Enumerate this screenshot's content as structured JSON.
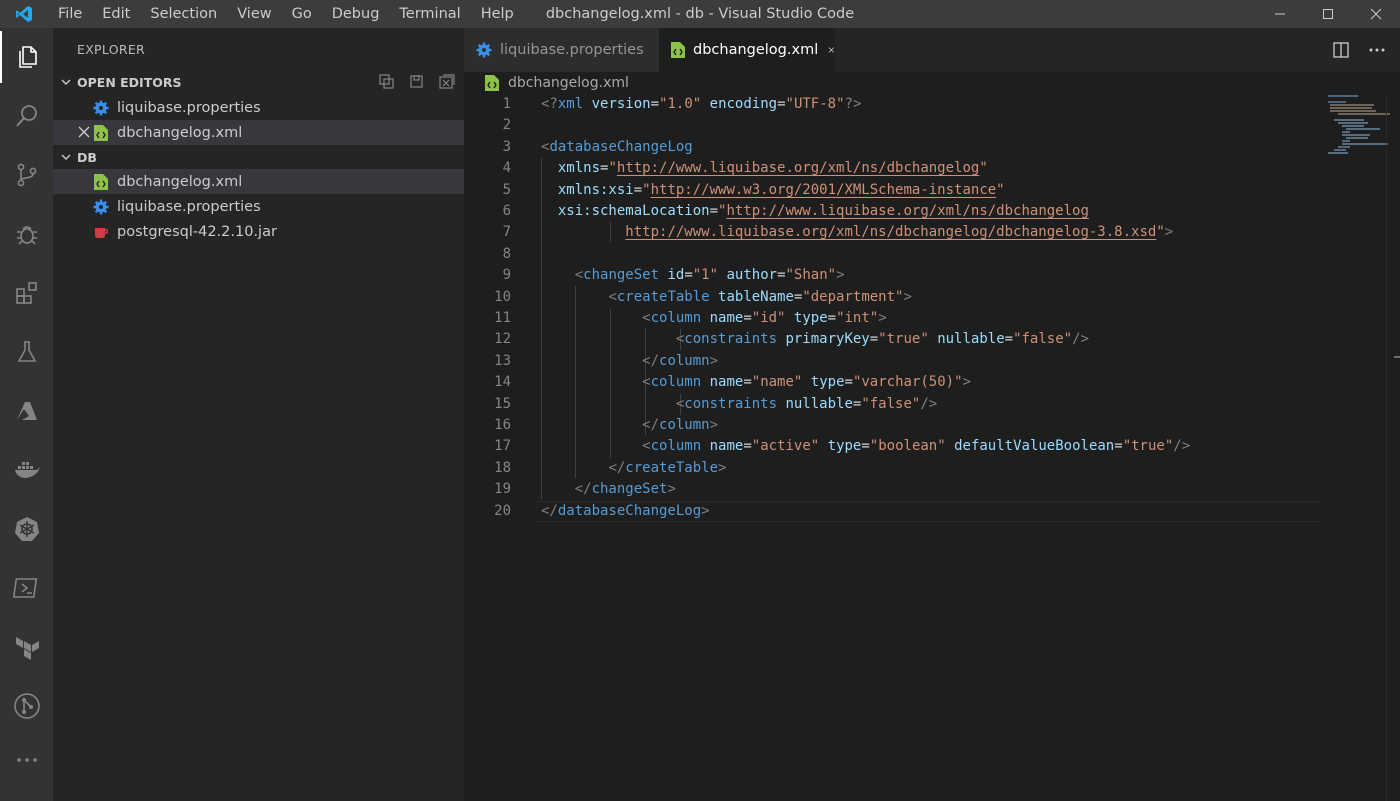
{
  "window": {
    "title": "dbchangelog.xml - db - Visual Studio Code",
    "menu": [
      "File",
      "Edit",
      "Selection",
      "View",
      "Go",
      "Debug",
      "Terminal",
      "Help"
    ]
  },
  "activity_bar": {
    "items": [
      "explorer-icon",
      "search-icon",
      "source-control-icon",
      "debug-icon",
      "extensions-icon",
      "test-flask-icon",
      "azure-icon",
      "docker-icon",
      "kubernetes-icon",
      "terminal-icon",
      "terraform-icon",
      "git-graph-icon",
      "more-icon"
    ],
    "active": "explorer-icon"
  },
  "sidebar": {
    "title": "EXPLORER",
    "open_editors": {
      "header": "OPEN EDITORS",
      "items": [
        {
          "label": "liquibase.properties",
          "icon": "gear-icon"
        },
        {
          "label": "dbchangelog.xml",
          "icon": "xml-file-icon"
        }
      ]
    },
    "folder": {
      "header": "DB",
      "items": [
        {
          "label": "dbchangelog.xml",
          "icon": "xml-file-icon"
        },
        {
          "label": "liquibase.properties",
          "icon": "gear-icon"
        },
        {
          "label": "postgresql-42.2.10.jar",
          "icon": "java-cup-icon"
        }
      ]
    }
  },
  "tabs": [
    {
      "label": "liquibase.properties",
      "icon": "gear-icon",
      "active": false
    },
    {
      "label": "dbchangelog.xml",
      "icon": "xml-file-icon",
      "active": true
    }
  ],
  "breadcrumb": {
    "file": "dbchangelog.xml"
  },
  "editor": {
    "lines": [
      [
        [
          "<?",
          "punct"
        ],
        [
          "xml",
          "tag"
        ],
        [
          " ",
          "plain"
        ],
        [
          "version",
          "attr"
        ],
        [
          "=",
          "plain"
        ],
        [
          "\"1.0\"",
          "str"
        ],
        [
          " ",
          "plain"
        ],
        [
          "encoding",
          "attr"
        ],
        [
          "=",
          "plain"
        ],
        [
          "\"UTF-8\"",
          "str"
        ],
        [
          "?>",
          "punct"
        ]
      ],
      [],
      [
        [
          "<",
          "punct"
        ],
        [
          "databaseChangeLog",
          "tag"
        ]
      ],
      [
        [
          "  ",
          "plain"
        ],
        [
          "xmlns",
          "attr"
        ],
        [
          "=",
          "plain"
        ],
        [
          "\"",
          "str"
        ],
        [
          "http://www.liquibase.org/xml/ns/dbchangelog",
          "url"
        ],
        [
          "\"",
          "str"
        ]
      ],
      [
        [
          "  ",
          "plain"
        ],
        [
          "xmlns:xsi",
          "attr"
        ],
        [
          "=",
          "plain"
        ],
        [
          "\"",
          "str"
        ],
        [
          "http://www.w3.org/2001/XMLSchema-instance",
          "url"
        ],
        [
          "\"",
          "str"
        ]
      ],
      [
        [
          "  ",
          "plain"
        ],
        [
          "xsi:schemaLocation",
          "attr"
        ],
        [
          "=",
          "plain"
        ],
        [
          "\"",
          "str"
        ],
        [
          "http://www.liquibase.org/xml/ns/dbchangelog",
          "url"
        ]
      ],
      [
        [
          "          ",
          "plain"
        ],
        [
          "http://www.liquibase.org/xml/ns/dbchangelog/dbchangelog-3.8.xsd",
          "url"
        ],
        [
          "\"",
          "str"
        ],
        [
          ">",
          "punct"
        ]
      ],
      [],
      [
        [
          "    ",
          "plain"
        ],
        [
          "<",
          "punct"
        ],
        [
          "changeSet",
          "tag"
        ],
        [
          " ",
          "plain"
        ],
        [
          "id",
          "attr"
        ],
        [
          "=",
          "plain"
        ],
        [
          "\"1\"",
          "str"
        ],
        [
          " ",
          "plain"
        ],
        [
          "author",
          "attr"
        ],
        [
          "=",
          "plain"
        ],
        [
          "\"Shan\"",
          "str"
        ],
        [
          ">",
          "punct"
        ]
      ],
      [
        [
          "        ",
          "plain"
        ],
        [
          "<",
          "punct"
        ],
        [
          "createTable",
          "tag"
        ],
        [
          " ",
          "plain"
        ],
        [
          "tableName",
          "attr"
        ],
        [
          "=",
          "plain"
        ],
        [
          "\"department\"",
          "str"
        ],
        [
          ">",
          "punct"
        ]
      ],
      [
        [
          "            ",
          "plain"
        ],
        [
          "<",
          "punct"
        ],
        [
          "column",
          "tag"
        ],
        [
          " ",
          "plain"
        ],
        [
          "name",
          "attr"
        ],
        [
          "=",
          "plain"
        ],
        [
          "\"id\"",
          "str"
        ],
        [
          " ",
          "plain"
        ],
        [
          "type",
          "attr"
        ],
        [
          "=",
          "plain"
        ],
        [
          "\"int\"",
          "str"
        ],
        [
          ">",
          "punct"
        ]
      ],
      [
        [
          "                ",
          "plain"
        ],
        [
          "<",
          "punct"
        ],
        [
          "constraints",
          "tag"
        ],
        [
          " ",
          "plain"
        ],
        [
          "primaryKey",
          "attr"
        ],
        [
          "=",
          "plain"
        ],
        [
          "\"true\"",
          "str"
        ],
        [
          " ",
          "plain"
        ],
        [
          "nullable",
          "attr"
        ],
        [
          "=",
          "plain"
        ],
        [
          "\"false\"",
          "str"
        ],
        [
          "/>",
          "punct"
        ]
      ],
      [
        [
          "            ",
          "plain"
        ],
        [
          "</",
          "punct"
        ],
        [
          "column",
          "tag"
        ],
        [
          ">",
          "punct"
        ]
      ],
      [
        [
          "            ",
          "plain"
        ],
        [
          "<",
          "punct"
        ],
        [
          "column",
          "tag"
        ],
        [
          " ",
          "plain"
        ],
        [
          "name",
          "attr"
        ],
        [
          "=",
          "plain"
        ],
        [
          "\"name\"",
          "str"
        ],
        [
          " ",
          "plain"
        ],
        [
          "type",
          "attr"
        ],
        [
          "=",
          "plain"
        ],
        [
          "\"varchar(50)\"",
          "str"
        ],
        [
          ">",
          "punct"
        ]
      ],
      [
        [
          "                ",
          "plain"
        ],
        [
          "<",
          "punct"
        ],
        [
          "constraints",
          "tag"
        ],
        [
          " ",
          "plain"
        ],
        [
          "nullable",
          "attr"
        ],
        [
          "=",
          "plain"
        ],
        [
          "\"false\"",
          "str"
        ],
        [
          "/>",
          "punct"
        ]
      ],
      [
        [
          "            ",
          "plain"
        ],
        [
          "</",
          "punct"
        ],
        [
          "column",
          "tag"
        ],
        [
          ">",
          "punct"
        ]
      ],
      [
        [
          "            ",
          "plain"
        ],
        [
          "<",
          "punct"
        ],
        [
          "column",
          "tag"
        ],
        [
          " ",
          "plain"
        ],
        [
          "name",
          "attr"
        ],
        [
          "=",
          "plain"
        ],
        [
          "\"active\"",
          "str"
        ],
        [
          " ",
          "plain"
        ],
        [
          "type",
          "attr"
        ],
        [
          "=",
          "plain"
        ],
        [
          "\"boolean\"",
          "str"
        ],
        [
          " ",
          "plain"
        ],
        [
          "defaultValueBoolean",
          "attr"
        ],
        [
          "=",
          "plain"
        ],
        [
          "\"true\"",
          "str"
        ],
        [
          "/>",
          "punct"
        ]
      ],
      [
        [
          "        ",
          "plain"
        ],
        [
          "</",
          "punct"
        ],
        [
          "createTable",
          "tag"
        ],
        [
          ">",
          "punct"
        ]
      ],
      [
        [
          "    ",
          "plain"
        ],
        [
          "</",
          "punct"
        ],
        [
          "changeSet",
          "tag"
        ],
        [
          ">",
          "punct"
        ]
      ],
      [
        [
          "</",
          "punct"
        ],
        [
          "databaseChangeLog",
          "tag"
        ],
        [
          ">",
          "punct"
        ]
      ]
    ]
  }
}
